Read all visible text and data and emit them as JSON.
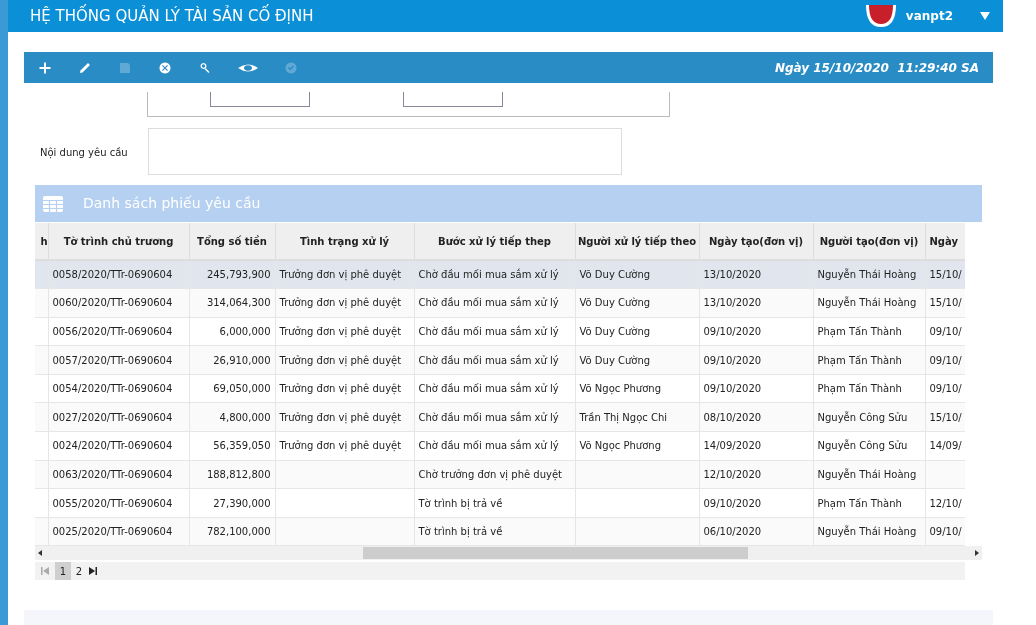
{
  "header": {
    "title": "HỆ THỐNG QUẢN LÝ TÀI SẢN CỐ ĐỊNH",
    "user": "vanpt2"
  },
  "toolbar": {
    "buttons": [
      {
        "kind": "add",
        "disabled": false
      },
      {
        "kind": "edit",
        "disabled": false
      },
      {
        "kind": "save",
        "disabled": true
      },
      {
        "kind": "delete",
        "disabled": false
      },
      {
        "kind": "search",
        "disabled": false
      },
      {
        "kind": "view",
        "disabled": false
      },
      {
        "kind": "approve",
        "disabled": true
      }
    ],
    "datetime": "Ngày 15/10/2020  11:29:40 SA"
  },
  "form": {
    "content_label": "Nội dung yêu cầu"
  },
  "section": {
    "title": "Danh sách phiếu yêu cầu"
  },
  "table": {
    "columns": [
      "h",
      "Tờ trình chủ trương",
      "Tổng số tiền",
      "Tình trạng xử lý",
      "Bước xử lý tiếp thep",
      "Người xử lý tiếp theo",
      "Ngày tạo(đơn vị)",
      "Người tạo(đơn vị)",
      "Ngày"
    ],
    "rows": [
      {
        "selected": true,
        "cells": [
          "",
          "0058/2020/TTr-0690604",
          "245,793,900",
          "Trưởng đơn vị phê duyệt",
          "Chờ đầu mối mua sắm xử lý",
          "Võ Duy Cường",
          "13/10/2020",
          "Nguyễn Thái Hoàng",
          "15/10/"
        ]
      },
      {
        "selected": false,
        "cells": [
          "",
          "0060/2020/TTr-0690604",
          "314,064,300",
          "Trưởng đơn vị phê duyệt",
          "Chờ đầu mối mua sắm xử lý",
          "Võ Duy Cường",
          "13/10/2020",
          "Nguyễn Thái Hoàng",
          "15/10/"
        ]
      },
      {
        "selected": false,
        "cells": [
          "",
          "0056/2020/TTr-0690604",
          "6,000,000",
          "Trưởng đơn vị phê duyệt",
          "Chờ đầu mối mua sắm xử lý",
          "Võ Duy Cường",
          "09/10/2020",
          "Phạm Tấn Thành",
          "09/10/"
        ]
      },
      {
        "selected": false,
        "cells": [
          "",
          "0057/2020/TTr-0690604",
          "26,910,000",
          "Trưởng đơn vị phê duyệt",
          "Chờ đầu mối mua sắm xử lý",
          "Võ Duy Cường",
          "09/10/2020",
          "Phạm Tấn Thành",
          "09/10/"
        ]
      },
      {
        "selected": false,
        "cells": [
          "",
          "0054/2020/TTr-0690604",
          "69,050,000",
          "Trưởng đơn vị phê duyệt",
          "Chờ đầu mối mua sắm xử lý",
          "Võ Ngọc Phương",
          "09/10/2020",
          "Phạm Tấn Thành",
          "09/10/"
        ]
      },
      {
        "selected": false,
        "cells": [
          "",
          "0027/2020/TTr-0690604",
          "4,800,000",
          "Trưởng đơn vị phê duyệt",
          "Chờ đầu mối mua sắm xử lý",
          "Trần Thị Ngọc Chi",
          "08/10/2020",
          "Nguyễn Công Sửu",
          "15/10/"
        ]
      },
      {
        "selected": false,
        "cells": [
          "",
          "0024/2020/TTr-0690604",
          "56,359,050",
          "Trưởng đơn vị phê duyệt",
          "Chờ đầu mối mua sắm xử lý",
          "Võ Ngọc Phương",
          "14/09/2020",
          "Nguyễn Công Sửu",
          "14/09/"
        ]
      },
      {
        "selected": false,
        "cells": [
          "",
          "0063/2020/TTr-0690604",
          "188,812,800",
          "",
          "Chờ trưởng đơn vị phê duyệt",
          "",
          "12/10/2020",
          "Nguyễn Thái Hoàng",
          ""
        ]
      },
      {
        "selected": false,
        "cells": [
          "",
          "0055/2020/TTr-0690604",
          "27,390,000",
          "",
          "Tờ trình bị trả về",
          "",
          "09/10/2020",
          "Phạm Tấn Thành",
          "12/10/"
        ]
      },
      {
        "selected": false,
        "cells": [
          "",
          "0025/2020/TTr-0690604",
          "782,100,000",
          "",
          "Tờ trình bị trả về",
          "",
          "06/10/2020",
          "Nguyễn Thái Hoàng",
          "09/10/"
        ]
      }
    ]
  },
  "pager": {
    "pages": [
      {
        "label": "1",
        "selected": true
      },
      {
        "label": "2",
        "selected": false
      }
    ]
  }
}
